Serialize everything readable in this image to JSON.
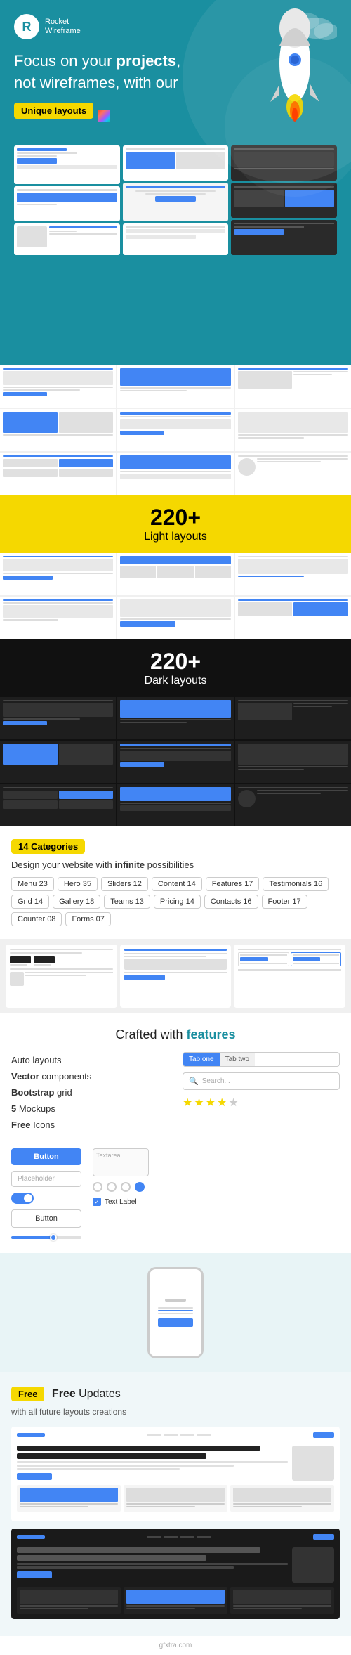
{
  "brand": {
    "logo_letter": "R",
    "name": "Rocket",
    "tagline": "Wireframe"
  },
  "hero": {
    "headline_line1": "Focus on your ",
    "headline_bold": "projects",
    "headline_line2": ", not wireframes, with our",
    "badge_text": "Unique layouts",
    "figma_icon_alt": "Figma"
  },
  "light_section": {
    "count": "220+",
    "label": "Light layouts"
  },
  "dark_section": {
    "count": "220+",
    "label": "Dark layouts"
  },
  "categories": {
    "badge": "14 Categories",
    "desc_start": "Design your website with ",
    "desc_bold": "infinite",
    "desc_end": " possibilities",
    "tags": [
      "Menu 23",
      "Hero 35",
      "Sliders 12",
      "Content 14",
      "Features 17",
      "Testimonials 16",
      "Grid 14",
      "Gallery 18",
      "Teams 13",
      "Pricing 14",
      "Contacts 16",
      "Footer 17",
      "Counter 08",
      "Forms 07"
    ]
  },
  "features": {
    "headline_start": "Crafted with ",
    "headline_bold": "features",
    "items": [
      {
        "label": "Auto layouts",
        "bold": ""
      },
      {
        "label": " layouts",
        "bold": "Auto"
      },
      {
        "label": " components",
        "bold": "Vector"
      },
      {
        "label": " grid",
        "bold": "Bootstrap"
      },
      {
        "label": " Mockups",
        "bold": "5"
      },
      {
        "label": " Icons",
        "bold": "Free"
      }
    ],
    "list": [
      {
        "plain": "Auto layouts",
        "bold": ""
      },
      {
        "plain": " components",
        "bold": "Vector"
      },
      {
        "plain": " grid",
        "bold": "Bootstrap"
      },
      {
        "plain": " Mockups",
        "bold": "5"
      },
      {
        "plain": " Icons",
        "bold": "Free"
      }
    ],
    "btn_blue": "Button",
    "btn_outline": "Button",
    "tab1": "Tab one",
    "tab2": "Tab two",
    "input_placeholder": "Placeholder",
    "search_placeholder": "Search...",
    "textarea_label": "Textarea",
    "checkbox_label": "Text Label"
  },
  "updates": {
    "badge": "Free",
    "headline": " Updates",
    "sub": "with all future layouts creations"
  },
  "watermark": {
    "text": "gfxtra.com"
  }
}
